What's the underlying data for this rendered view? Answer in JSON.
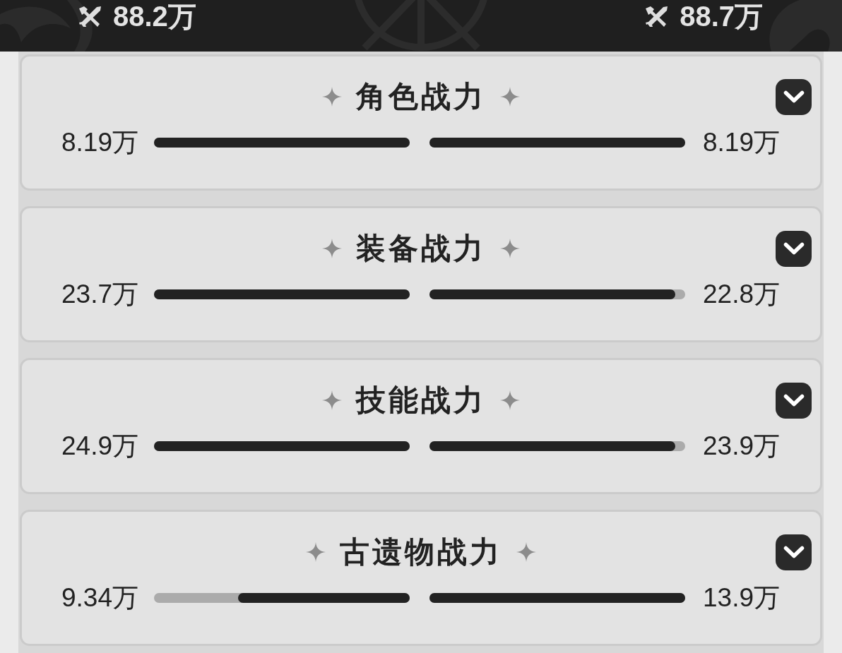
{
  "header": {
    "left_score": "88.2万",
    "right_score": "88.7万"
  },
  "sections": [
    {
      "title": "角色战力",
      "expanded": false,
      "left": {
        "value": "8.19万",
        "level": 1
      },
      "right": {
        "value": "8.19万",
        "level": 1
      }
    },
    {
      "title": "装备战力",
      "expanded": false,
      "left": {
        "value": "23.7万",
        "level": 1
      },
      "right": {
        "value": "22.8万",
        "level": 0.96
      }
    },
    {
      "title": "技能战力",
      "expanded": false,
      "left": {
        "value": "24.9万",
        "level": 1
      },
      "right": {
        "value": "23.9万",
        "level": 0.96
      }
    },
    {
      "title": "古遗物战力",
      "expanded": false,
      "left": {
        "value": "9.34万",
        "level": 0.67
      },
      "right": {
        "value": "13.9万",
        "level": 1
      }
    }
  ]
}
